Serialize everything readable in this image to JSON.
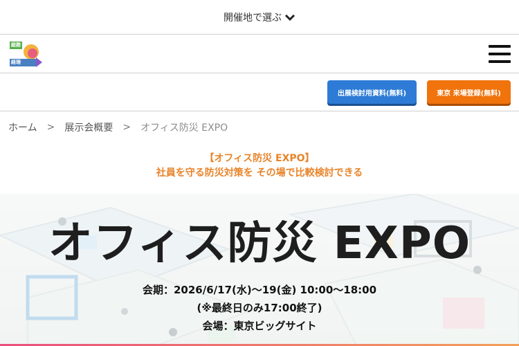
{
  "topbar": {
    "label": "開催地で選ぶ",
    "chevron_icon": "chevron-down-icon"
  },
  "header": {
    "logo": {
      "line1": "総務",
      "line2": "人事",
      "line3": "経理Week"
    },
    "menu_icon": "hamburger-menu-icon"
  },
  "cta": {
    "request_materials": "出展検討用資料(無料)",
    "register": "東京 来場登録(無料)",
    "blue": "#2d7bd6",
    "orange": "#f0730c"
  },
  "breadcrumb": {
    "items": [
      "ホーム",
      "展示会概要",
      "オフィス防災 EXPO"
    ],
    "separator": ">"
  },
  "tagline": {
    "line1": "【オフィス防災 EXPO】",
    "line2": "社員を守る防災対策を その場で比較検討できる",
    "color": "#e8842a"
  },
  "hero": {
    "title": "オフィス防災 EXPO",
    "period": "会期：2026/6/17(水)～19(金) 10:00～18:00",
    "note": "(※最終日のみ17:00終了)",
    "venue": "会場：東京ビッグサイト"
  }
}
